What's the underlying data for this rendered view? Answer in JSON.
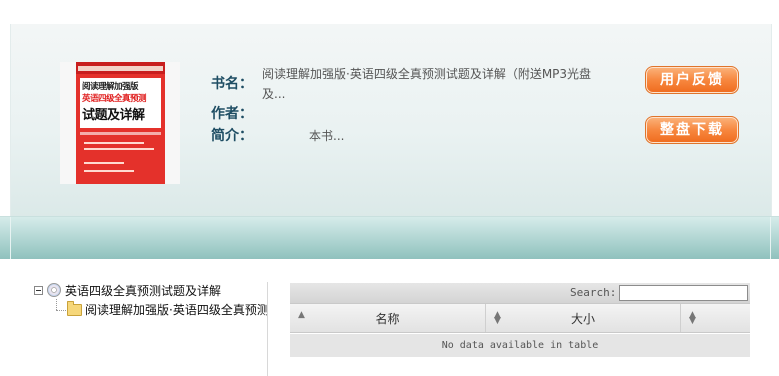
{
  "book": {
    "cover_lines": [
      "阅读理解加强版",
      "英语四级全真预测",
      "试题及详解"
    ],
    "title_label": "书名：",
    "title_value": "阅读理解加强版·英语四级全真预测试题及详解（附送MP3光盘及...",
    "author_label": "作者：",
    "author_value": "",
    "summary_label": "简介：",
    "summary_value": "本书..."
  },
  "actions": {
    "feedback_label": "用户反馈",
    "download_label": "整盘下载",
    "button_color": "#f7873f"
  },
  "tree": {
    "root_label": "英语四级全真预测试题及详解",
    "root_icon": "disc-icon",
    "child_label": "阅读理解加强版·英语四级全真预测",
    "child_icon": "folder-icon"
  },
  "table": {
    "search_label": "Search:",
    "search_value": "",
    "columns": [
      "名称",
      "大小",
      ""
    ],
    "empty_text": "No data available in table"
  }
}
